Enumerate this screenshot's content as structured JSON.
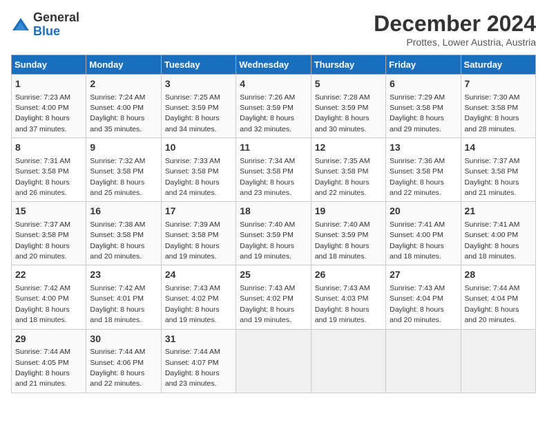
{
  "logo": {
    "general": "General",
    "blue": "Blue"
  },
  "title": "December 2024",
  "subtitle": "Prottes, Lower Austria, Austria",
  "days_header": [
    "Sunday",
    "Monday",
    "Tuesday",
    "Wednesday",
    "Thursday",
    "Friday",
    "Saturday"
  ],
  "weeks": [
    [
      {
        "day": "1",
        "sunrise": "7:23 AM",
        "sunset": "4:00 PM",
        "daylight": "8 hours and 37 minutes."
      },
      {
        "day": "2",
        "sunrise": "7:24 AM",
        "sunset": "4:00 PM",
        "daylight": "8 hours and 35 minutes."
      },
      {
        "day": "3",
        "sunrise": "7:25 AM",
        "sunset": "3:59 PM",
        "daylight": "8 hours and 34 minutes."
      },
      {
        "day": "4",
        "sunrise": "7:26 AM",
        "sunset": "3:59 PM",
        "daylight": "8 hours and 32 minutes."
      },
      {
        "day": "5",
        "sunrise": "7:28 AM",
        "sunset": "3:59 PM",
        "daylight": "8 hours and 30 minutes."
      },
      {
        "day": "6",
        "sunrise": "7:29 AM",
        "sunset": "3:58 PM",
        "daylight": "8 hours and 29 minutes."
      },
      {
        "day": "7",
        "sunrise": "7:30 AM",
        "sunset": "3:58 PM",
        "daylight": "8 hours and 28 minutes."
      }
    ],
    [
      {
        "day": "8",
        "sunrise": "7:31 AM",
        "sunset": "3:58 PM",
        "daylight": "8 hours and 26 minutes."
      },
      {
        "day": "9",
        "sunrise": "7:32 AM",
        "sunset": "3:58 PM",
        "daylight": "8 hours and 25 minutes."
      },
      {
        "day": "10",
        "sunrise": "7:33 AM",
        "sunset": "3:58 PM",
        "daylight": "8 hours and 24 minutes."
      },
      {
        "day": "11",
        "sunrise": "7:34 AM",
        "sunset": "3:58 PM",
        "daylight": "8 hours and 23 minutes."
      },
      {
        "day": "12",
        "sunrise": "7:35 AM",
        "sunset": "3:58 PM",
        "daylight": "8 hours and 22 minutes."
      },
      {
        "day": "13",
        "sunrise": "7:36 AM",
        "sunset": "3:58 PM",
        "daylight": "8 hours and 22 minutes."
      },
      {
        "day": "14",
        "sunrise": "7:37 AM",
        "sunset": "3:58 PM",
        "daylight": "8 hours and 21 minutes."
      }
    ],
    [
      {
        "day": "15",
        "sunrise": "7:37 AM",
        "sunset": "3:58 PM",
        "daylight": "8 hours and 20 minutes."
      },
      {
        "day": "16",
        "sunrise": "7:38 AM",
        "sunset": "3:58 PM",
        "daylight": "8 hours and 20 minutes."
      },
      {
        "day": "17",
        "sunrise": "7:39 AM",
        "sunset": "3:58 PM",
        "daylight": "8 hours and 19 minutes."
      },
      {
        "day": "18",
        "sunrise": "7:40 AM",
        "sunset": "3:59 PM",
        "daylight": "8 hours and 19 minutes."
      },
      {
        "day": "19",
        "sunrise": "7:40 AM",
        "sunset": "3:59 PM",
        "daylight": "8 hours and 18 minutes."
      },
      {
        "day": "20",
        "sunrise": "7:41 AM",
        "sunset": "4:00 PM",
        "daylight": "8 hours and 18 minutes."
      },
      {
        "day": "21",
        "sunrise": "7:41 AM",
        "sunset": "4:00 PM",
        "daylight": "8 hours and 18 minutes."
      }
    ],
    [
      {
        "day": "22",
        "sunrise": "7:42 AM",
        "sunset": "4:00 PM",
        "daylight": "8 hours and 18 minutes."
      },
      {
        "day": "23",
        "sunrise": "7:42 AM",
        "sunset": "4:01 PM",
        "daylight": "8 hours and 18 minutes."
      },
      {
        "day": "24",
        "sunrise": "7:43 AM",
        "sunset": "4:02 PM",
        "daylight": "8 hours and 19 minutes."
      },
      {
        "day": "25",
        "sunrise": "7:43 AM",
        "sunset": "4:02 PM",
        "daylight": "8 hours and 19 minutes."
      },
      {
        "day": "26",
        "sunrise": "7:43 AM",
        "sunset": "4:03 PM",
        "daylight": "8 hours and 19 minutes."
      },
      {
        "day": "27",
        "sunrise": "7:43 AM",
        "sunset": "4:04 PM",
        "daylight": "8 hours and 20 minutes."
      },
      {
        "day": "28",
        "sunrise": "7:44 AM",
        "sunset": "4:04 PM",
        "daylight": "8 hours and 20 minutes."
      }
    ],
    [
      {
        "day": "29",
        "sunrise": "7:44 AM",
        "sunset": "4:05 PM",
        "daylight": "8 hours and 21 minutes."
      },
      {
        "day": "30",
        "sunrise": "7:44 AM",
        "sunset": "4:06 PM",
        "daylight": "8 hours and 22 minutes."
      },
      {
        "day": "31",
        "sunrise": "7:44 AM",
        "sunset": "4:07 PM",
        "daylight": "8 hours and 23 minutes."
      },
      null,
      null,
      null,
      null
    ]
  ]
}
